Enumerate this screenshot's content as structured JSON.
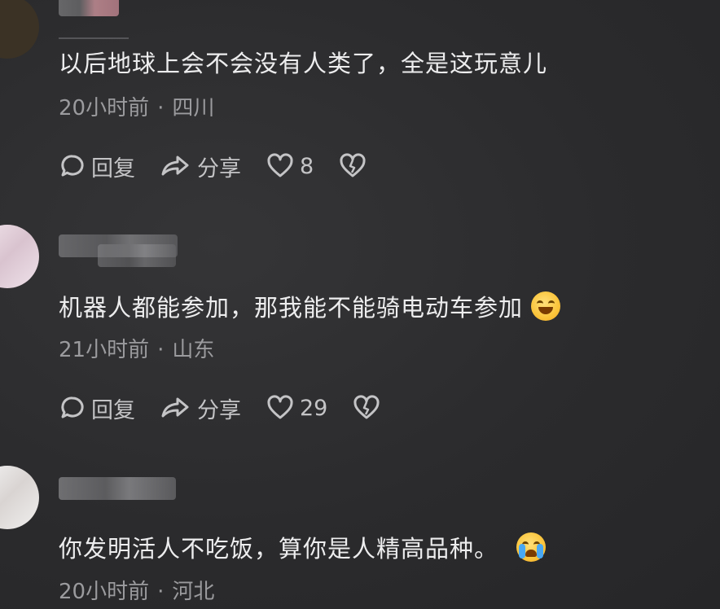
{
  "comments": [
    {
      "text": "以后地球上会不会没有人类了，全是这玩意儿",
      "time": "20小时前",
      "separator": "·",
      "location": "四川",
      "reply_label": "回复",
      "share_label": "分享",
      "like_count": "8"
    },
    {
      "text": "机器人都能参加，那我能不能骑电动车参加",
      "time": "21小时前",
      "separator": "·",
      "location": "山东",
      "reply_label": "回复",
      "share_label": "分享",
      "like_count": "29",
      "emoji": "grinning-sweat-emoji"
    },
    {
      "text": "你发明活人不吃饭，算你是人精高品种。",
      "time": "20小时前",
      "separator": "·",
      "location": "河北",
      "emoji": "crying-emoji"
    }
  ]
}
